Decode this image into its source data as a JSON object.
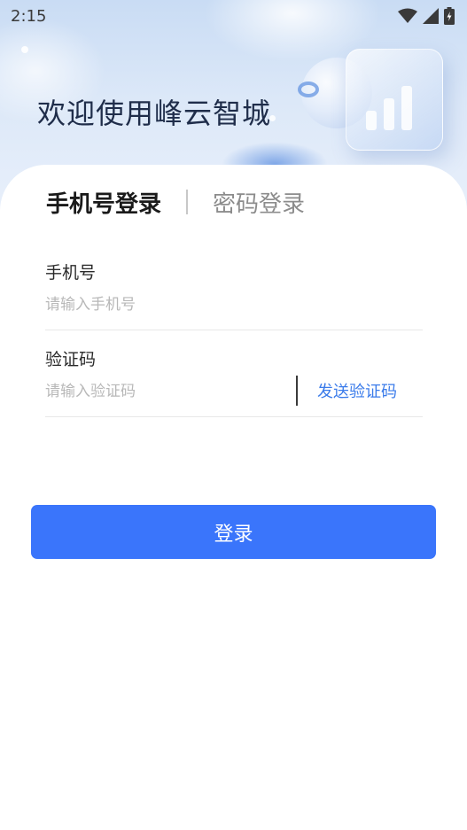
{
  "status_bar": {
    "time": "2:15"
  },
  "header": {
    "welcome": "欢迎使用峰云智城"
  },
  "tabs": {
    "active": "手机号登录",
    "inactive": "密码登录"
  },
  "phone": {
    "label": "手机号",
    "placeholder": "请输入手机号",
    "value": ""
  },
  "code": {
    "label": "验证码",
    "placeholder": "请输入验证码",
    "value": "",
    "send_label": "发送验证码"
  },
  "login": {
    "label": "登录"
  },
  "colors": {
    "accent": "#3a75fb",
    "link": "#3a7bea",
    "title": "#1f2d4a"
  }
}
